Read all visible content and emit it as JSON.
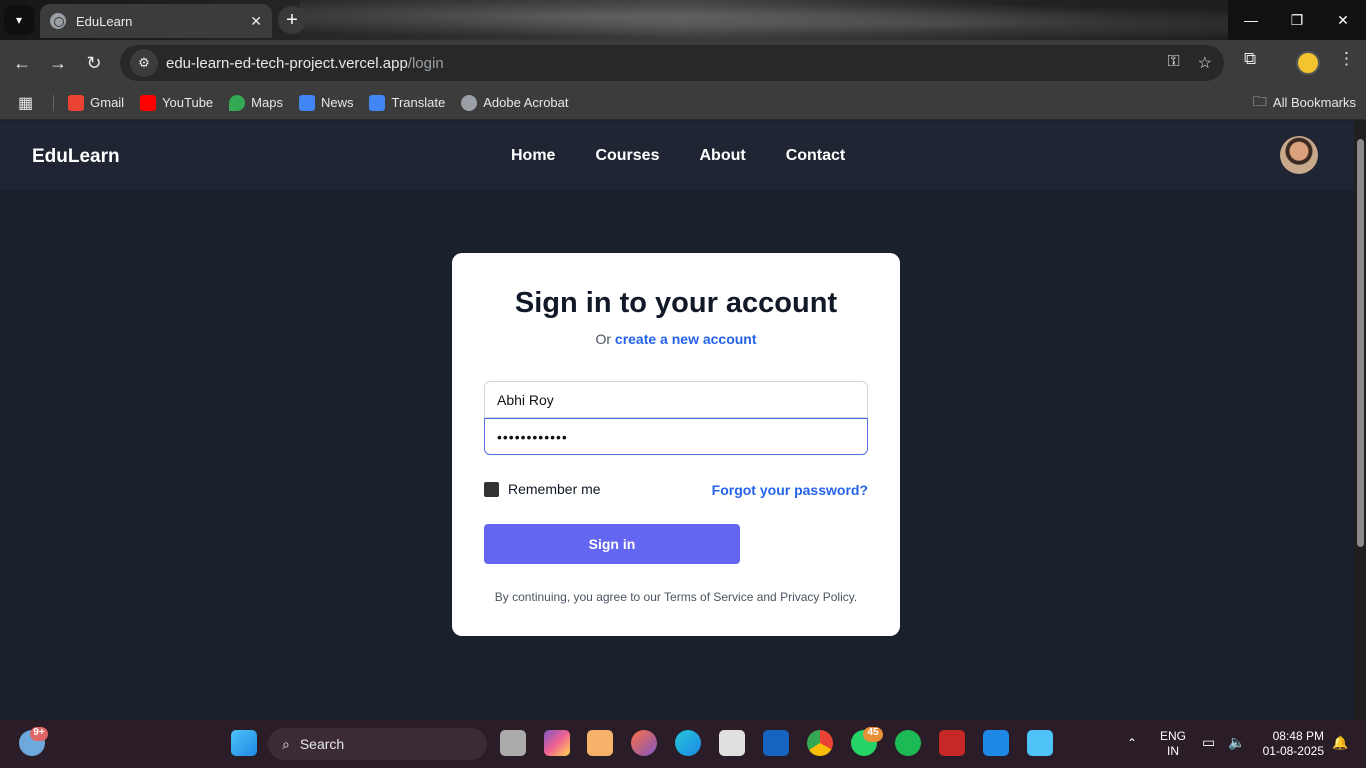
{
  "browser": {
    "tab_title": "EduLearn",
    "tab_close": "✕",
    "new_tab": "+",
    "url_host": "edu-learn-ed-tech-project.vercel.app",
    "url_path": "/login",
    "bookmarks": [
      {
        "label": "Gmail",
        "color": "#ea4335"
      },
      {
        "label": "YouTube",
        "color": "#ff0000"
      },
      {
        "label": "Maps",
        "color": "#34a853"
      },
      {
        "label": "News",
        "color": "#4285f4"
      },
      {
        "label": "Translate",
        "color": "#4285f4"
      },
      {
        "label": "Adobe Acrobat",
        "color": "#9aa0a6"
      }
    ],
    "all_bookmarks": "All Bookmarks"
  },
  "site": {
    "brand": "EduLearn",
    "nav": [
      "Home",
      "Courses",
      "About",
      "Contact"
    ]
  },
  "login": {
    "title": "Sign in to your account",
    "subtitle_prefix": "Or",
    "create_link": "create a new account",
    "username_value": "Abhi Roy",
    "password_value": "••••••••••••",
    "remember_label": "Remember me",
    "forgot_link": "Forgot your password?",
    "signin_button": "Sign in",
    "terms_text": "By continuing, you agree to our Terms of Service and Privacy Policy."
  },
  "taskbar": {
    "search_label": "Search",
    "weather_badge": "9+",
    "whatsapp_badge": "45",
    "lang_line1": "ENG",
    "lang_line2": "IN",
    "time": "08:48 PM",
    "date": "01-08-2025"
  },
  "colors": {
    "accent": "#6366f1",
    "link": "#2563eb",
    "page_bg": "#1a202c"
  }
}
